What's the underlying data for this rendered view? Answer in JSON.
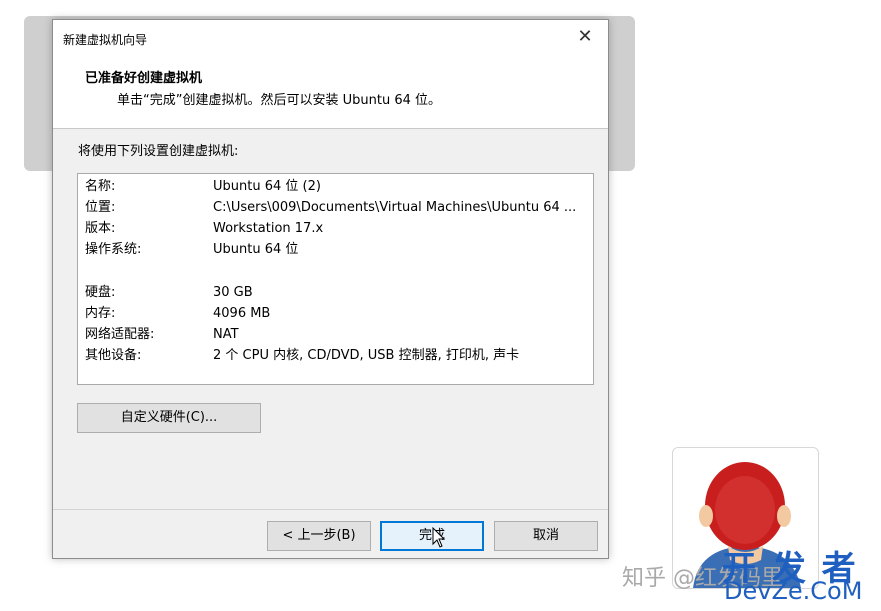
{
  "dialog": {
    "title": "新建虚拟机向导",
    "close_glyph": "✕",
    "header_title": "已准备好创建虚拟机",
    "header_subtitle": "单击“完成”创建虚拟机。然后可以安装 Ubuntu 64 位。",
    "intro": "将使用下列设置创建虚拟机:",
    "summary": [
      {
        "key": "名称:",
        "value": "Ubuntu 64 位 (2)"
      },
      {
        "key": "位置:",
        "value": "C:\\Users\\009\\Documents\\Virtual Machines\\Ubuntu 64 ..."
      },
      {
        "key": "版本:",
        "value": "Workstation 17.x"
      },
      {
        "key": "操作系统:",
        "value": "Ubuntu 64 位"
      },
      {
        "key": "硬盘:",
        "value": "30 GB"
      },
      {
        "key": "内存:",
        "value": "4096 MB"
      },
      {
        "key": "网络适配器:",
        "value": "NAT"
      },
      {
        "key": "其他设备:",
        "value": "2 个 CPU 内核, CD/DVD, USB 控制器, 打印机, 声卡"
      }
    ],
    "customize_button": "自定义硬件(C)...",
    "back_button": "< 上一步(B)",
    "finish_button": "完成",
    "cancel_button": "取消"
  },
  "watermark": {
    "zhihu_text": "知乎 @红发码里",
    "logo_big": "开 发 者",
    "logo_small": "DevZe.CoM"
  },
  "colors": {
    "accent": "#0078d7",
    "logo": "#1f5fbf"
  }
}
